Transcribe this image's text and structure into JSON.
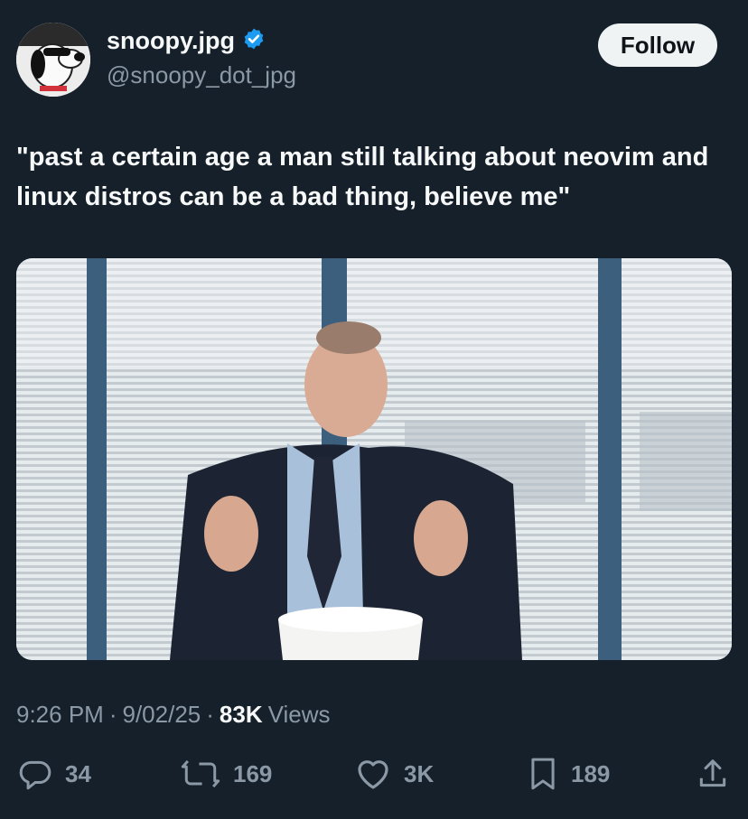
{
  "author": {
    "display_name": "snoopy.jpg",
    "handle": "@snoopy_dot_jpg",
    "verified_icon": "verified-badge-icon",
    "avatar": "snoopy-avatar"
  },
  "follow_label": "Follow",
  "tweet_text": "\"past a certain age a man still talking about neovim and linux distros can be a bad thing, believe me\"",
  "media": {
    "type": "photo"
  },
  "meta": {
    "time": "9:26 PM",
    "sep1": "·",
    "date": "9/02/25",
    "sep2": "·",
    "views_count": "83K",
    "views_label": "Views"
  },
  "actions": {
    "replies": "34",
    "reposts": "169",
    "likes": "3K",
    "bookmarks": "189"
  },
  "colors": {
    "background": "#15202b",
    "text": "#f7f9f9",
    "muted": "#8b98a5",
    "verified": "#1d9bf0"
  }
}
